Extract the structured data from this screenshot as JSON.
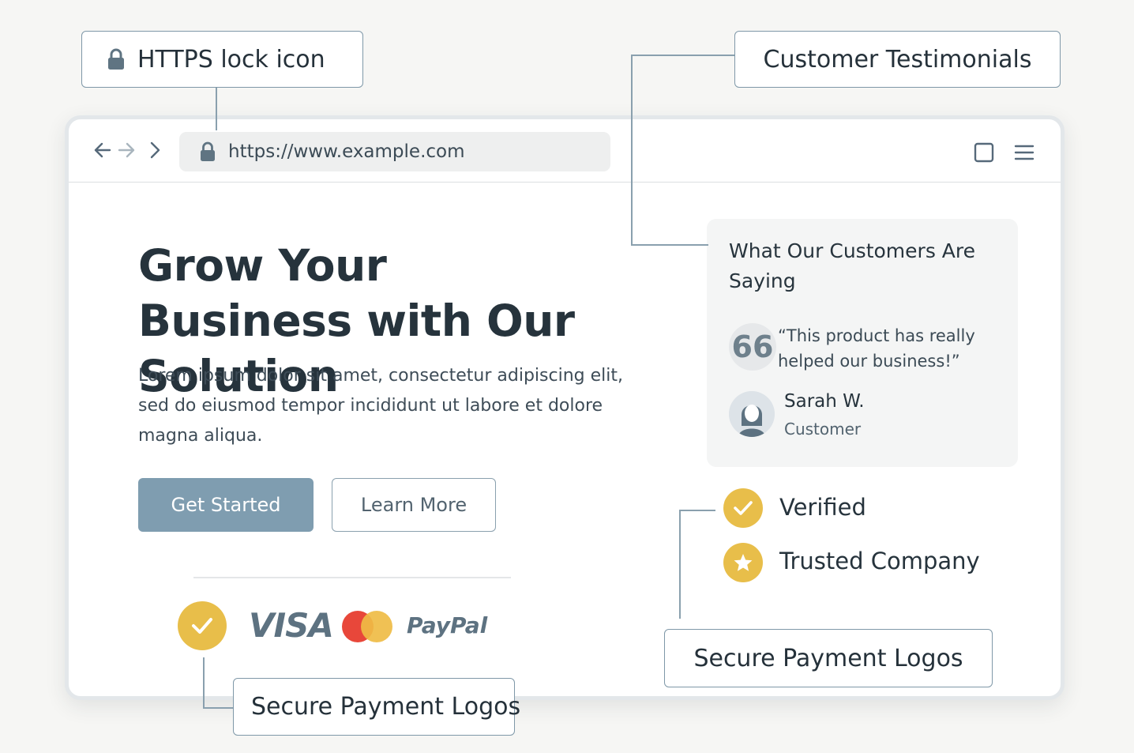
{
  "annotations": {
    "lock": "HTTPS lock icon",
    "testimonials": "Customer Testimonials",
    "payment_right": "Secure Payment Logos",
    "payment_bottom": "Secure Payment Logos"
  },
  "browser": {
    "url": "https://www.example.com",
    "icons": [
      "back-arrow",
      "forward-arrow",
      "chevron-right",
      "lock",
      "window-square",
      "hamburger-menu"
    ]
  },
  "hero": {
    "title": "Grow Your Business with Our Solution",
    "body": "Lorem ipsum dolor sit amet, consectetur adipiscing elit, sed do eiusmod tempor incididunt ut labore et dolore magna aliqua.",
    "primary_button": "Get Started",
    "secondary_button": "Learn More"
  },
  "payment": {
    "logos": [
      "VISA",
      "PayPal"
    ],
    "icons": [
      "check-badge",
      "mastercard-logo"
    ]
  },
  "testimonial": {
    "heading": "What Our Customers Are Saying",
    "quote_mark": "66",
    "quote": "“This product has really helped our business!”",
    "name": "Sarah W.",
    "role": "Customer"
  },
  "trust": {
    "verified": "Verified",
    "trusted": "Trusted Company"
  },
  "colors": {
    "accent_gold": "#e8be4a",
    "primary_button": "#7f9db0",
    "text_dark": "#26333c",
    "mastercard_red": "#e8473a",
    "mastercard_yellow": "#efbc45"
  }
}
